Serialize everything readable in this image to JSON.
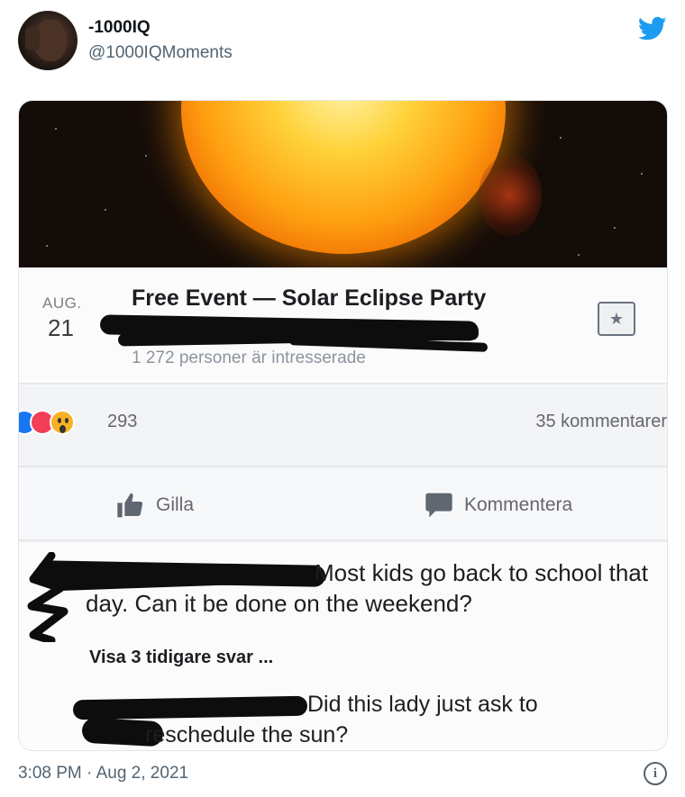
{
  "tweet": {
    "display_name": "-1000IQ",
    "handle": "@1000IQMoments",
    "timestamp": "3:08 PM · Aug 2, 2021",
    "brand_color": "#1d9bf0",
    "icons": {
      "brand": "twitter-bird-icon",
      "info": "info-icon"
    }
  },
  "event": {
    "month": "AUG.",
    "day": "21",
    "title": "Free Event — Solar Eclipse Party",
    "interested": "1 272 personer är intresserade",
    "calendar_icon": "calendar-star-icon"
  },
  "engagement": {
    "reaction_count": "293",
    "comments_count": "35 kommentarer",
    "reactions": [
      "like",
      "love",
      "wow"
    ]
  },
  "actions": {
    "like_label": "Gilla",
    "comment_label": "Kommentera"
  },
  "comments": {
    "first": "Most kids go back to school that day. Can it be done on the weekend?",
    "view_replies": "Visa 3 tidigare svar ...",
    "reply": "Did this lady just ask to reschedule the sun?"
  }
}
